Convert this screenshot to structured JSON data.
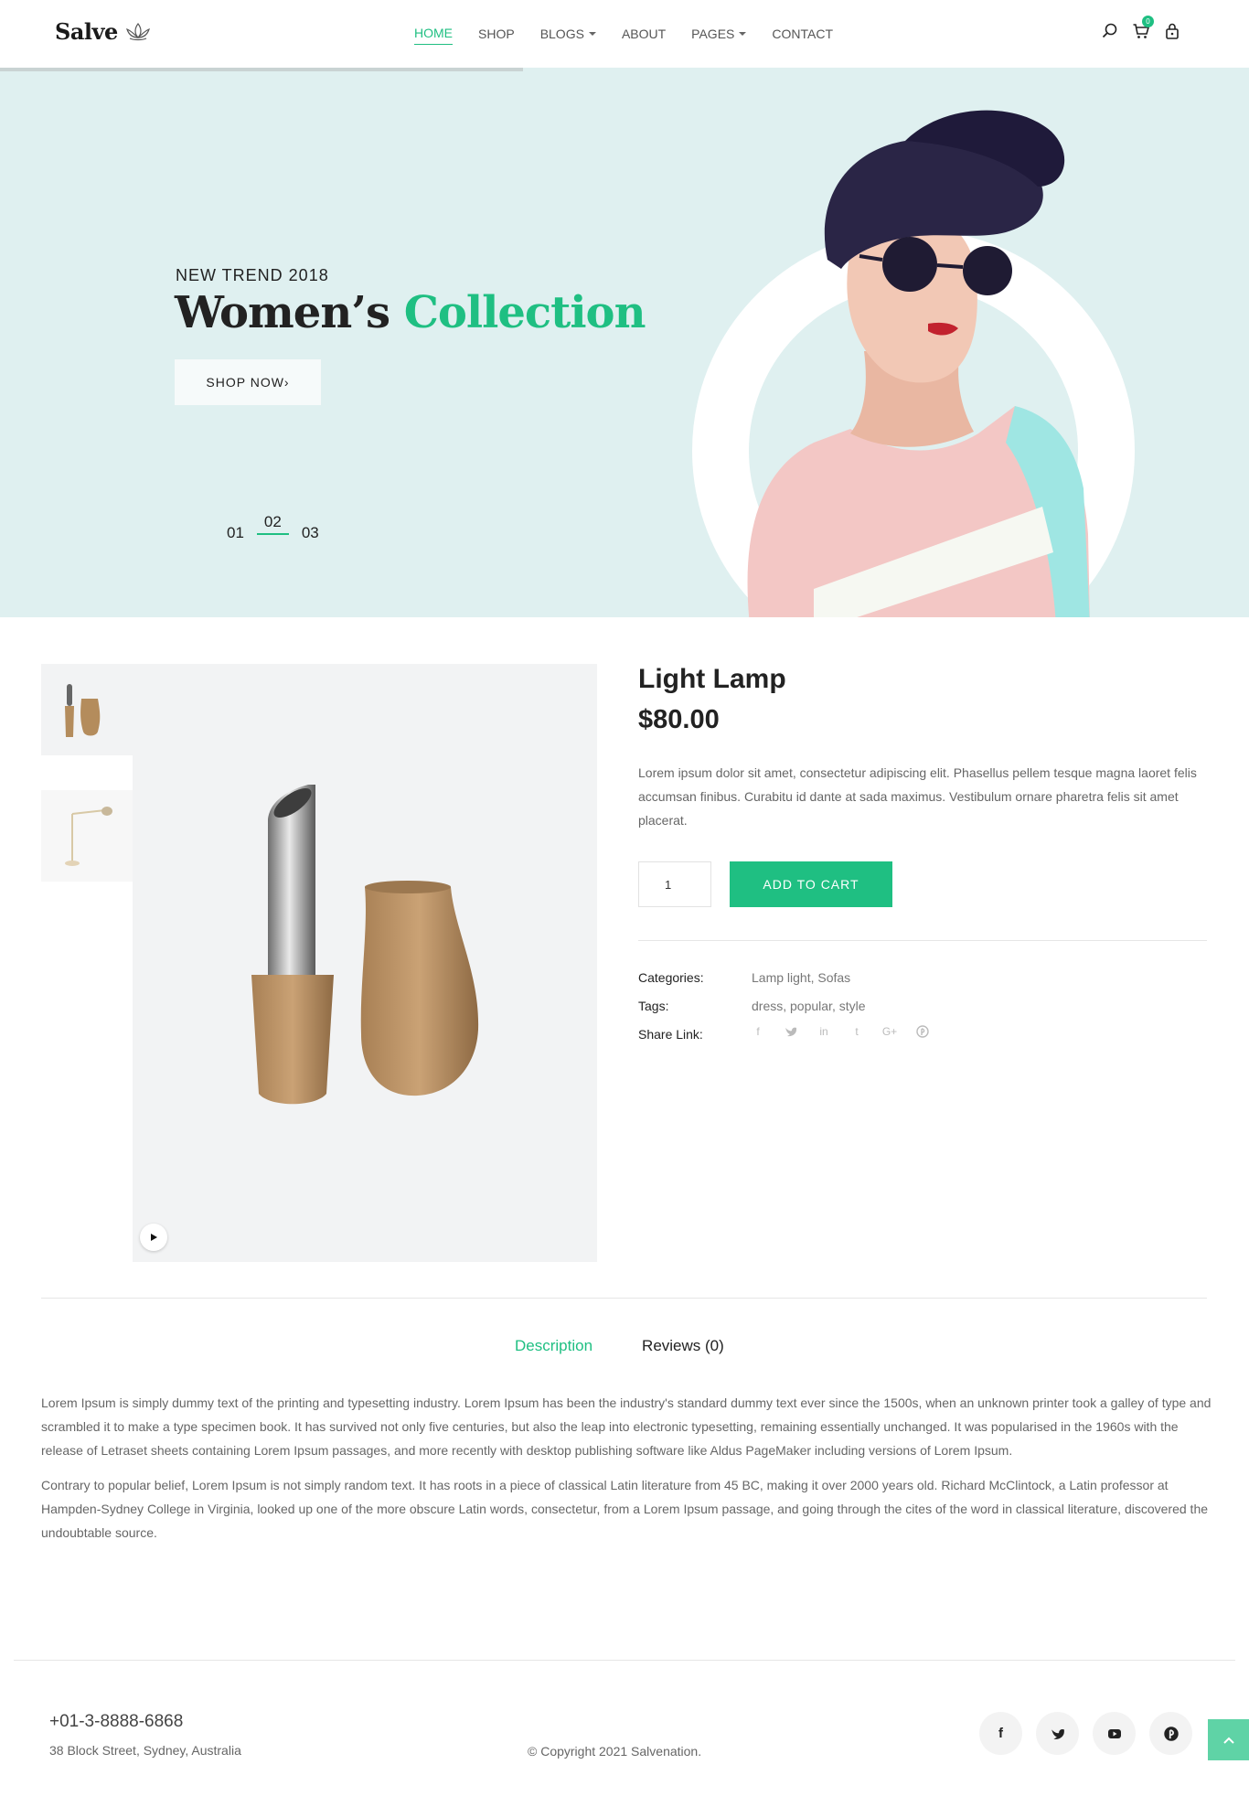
{
  "header": {
    "logo_text": "Salve",
    "nav": [
      {
        "label": "HOME"
      },
      {
        "label": "SHOP"
      },
      {
        "label": "BLOGS"
      },
      {
        "label": "ABOUT"
      },
      {
        "label": "PAGES"
      },
      {
        "label": "CONTACT"
      }
    ],
    "cart_count": "0"
  },
  "hero": {
    "eyebrow": "NEW TREND 2018",
    "title_main": "Women’s",
    "title_accent": "Collection",
    "cta": "SHOP NOW",
    "cta_arrow": "›",
    "slides": [
      "01",
      "02",
      "03"
    ]
  },
  "product": {
    "title": "Light Lamp",
    "price": "$80.00",
    "description": "Lorem ipsum dolor sit amet, consectetur adipiscing elit. Phasellus pellem tesque magna laoret felis accumsan finibus. Curabitu id dante at sada maximus. Vestibulum ornare pharetra felis sit amet placerat.",
    "quantity": "1",
    "add_to_cart": "ADD TO CART",
    "categories_label": "Categories:",
    "categories_value": "Lamp light, Sofas",
    "tags_label": "Tags:",
    "tags_value": "dress, popular, style",
    "share_label": "Share Link:",
    "share_icons": [
      "facebook-icon",
      "twitter-icon",
      "linkedin-icon",
      "tumblr-icon",
      "google-plus-icon",
      "pinterest-icon"
    ]
  },
  "tabs": [
    {
      "label": "Description"
    },
    {
      "label": "Reviews (0)"
    }
  ],
  "description": {
    "p1": "Lorem Ipsum is simply dummy text of the printing and typesetting industry. Lorem Ipsum has been the industry's standard dummy text ever since the 1500s, when an unknown printer took a galley of type and scrambled it to make a type specimen book. It has survived not only five centuries, but also the leap into electronic typesetting, remaining essentially unchanged. It was popularised in the 1960s with the release of Letraset sheets containing Lorem Ipsum passages, and more recently with desktop publishing software like Aldus PageMaker including versions of Lorem Ipsum.",
    "p2": "Contrary to popular belief, Lorem Ipsum is not simply random text. It has roots in a piece of classical Latin literature from 45 BC, making it over 2000 years old. Richard McClintock, a Latin professor at Hampden-Sydney College in Virginia, looked up one of the more obscure Latin words, consectetur, from a Lorem Ipsum passage, and going through the cites of the word in classical literature, discovered the undoubtable source."
  },
  "footer": {
    "phone": "+01-3-8888-6868",
    "address": "38 Block Street, Sydney, Australia",
    "copyright": "© Copyright 2021 Salvenation.",
    "social": [
      "facebook-icon",
      "twitter-icon",
      "youtube-icon",
      "pinterest-icon"
    ]
  },
  "colors": {
    "accent": "#1fbf82",
    "hero_bg": "#dff0f0",
    "image_bg": "#f2f3f4"
  }
}
